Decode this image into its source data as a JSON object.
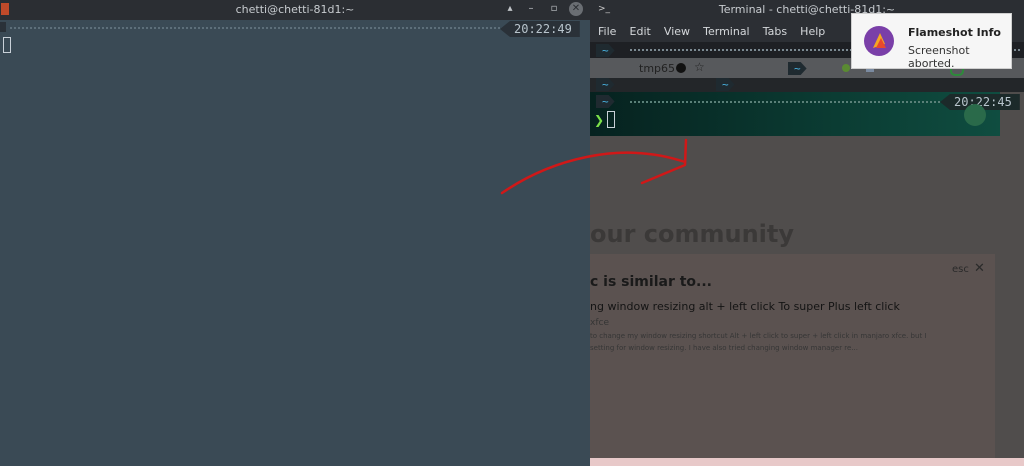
{
  "left_terminal": {
    "title": "chetti@chetti-81d1:~",
    "clock": "20:22:49"
  },
  "right_terminal": {
    "title": "Terminal - chetti@chetti-81d1:~",
    "menu": [
      "File",
      "Edit",
      "View",
      "Terminal",
      "Tabs",
      "Help"
    ],
    "clock": "20:22:45",
    "prompt_symbol": "❯",
    "tilde": "~"
  },
  "background_page": {
    "tab_label": "tmp65",
    "heading_partial": "our community",
    "dialog_title_partial": "c is similar to...",
    "esc_label": "esc",
    "question_title_partial": "ng window resizing alt + left click To super Plus left click",
    "tag_partial": "xfce",
    "excerpt_line1": "to change my window resizing shortcut Alt + left click to super + left click in manjaro xfce. but I",
    "excerpt_line2": "setting for window resizing. I have also tried changing window manager re..."
  },
  "notification": {
    "title": "Flameshot Info",
    "message": "Screenshot aborted."
  },
  "colors": {
    "left_bg": "#3a4a55",
    "titlebar": "#2b2e33",
    "annotation_arrow": "#d01818",
    "tilde": "#4ab8e8",
    "prompt": "#7ce24a"
  }
}
